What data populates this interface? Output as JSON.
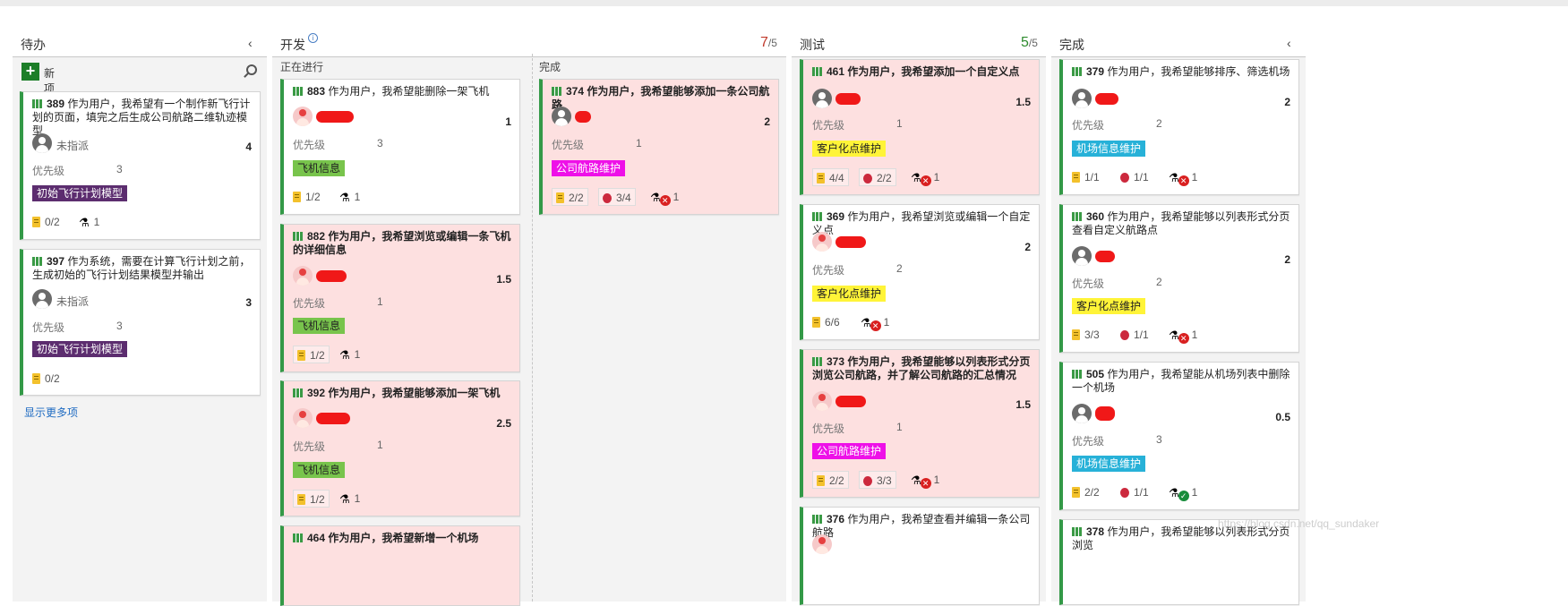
{
  "columns": {
    "todo": {
      "title": "待办",
      "new_item": "新项",
      "show_more": "显示更多项"
    },
    "dev": {
      "title": "开发",
      "wip_count": "7",
      "wip_limit": "/5",
      "sub_doing": "正在进行",
      "sub_done": "完成"
    },
    "test": {
      "title": "测试",
      "wip_count": "5",
      "wip_limit": "/5"
    },
    "done": {
      "title": "完成"
    }
  },
  "labels": {
    "priority": "优先级",
    "unassigned": "未指派"
  },
  "colors": {
    "story_green": "#339947",
    "wip_over": "#c0392b",
    "wip_ok": "#2e8b2e"
  },
  "cards": {
    "c389": {
      "id": "389",
      "title": "作为用户，我希望有一个制作新飞行计划的页面，填完之后生成公司航路二维轨迹模型",
      "effort": "4",
      "priority": "3",
      "tag": "初始飞行计划模型",
      "tasks": "0/2",
      "tests": "1"
    },
    "c397": {
      "id": "397",
      "title": "作为系统，需要在计算飞行计划之前，生成初始的飞行计划结果模型并输出",
      "effort": "3",
      "priority": "3",
      "tag": "初始飞行计划模型",
      "tasks": "0/2"
    },
    "c883": {
      "id": "883",
      "title": "作为用户，我希望能删除一架飞机",
      "effort": "1",
      "priority": "3",
      "tag": "飞机信息",
      "tasks": "1/2",
      "tests": "1"
    },
    "c882": {
      "id": "882",
      "title": "作为用户，我希望浏览或编辑一条飞机的详细信息",
      "effort": "1.5",
      "priority": "1",
      "tag": "飞机信息",
      "tasks": "1/2",
      "tests": "1"
    },
    "c392": {
      "id": "392",
      "title": "作为用户，我希望能够添加一架飞机",
      "effort": "2.5",
      "priority": "1",
      "tag": "飞机信息",
      "tasks": "1/2",
      "tests": "1"
    },
    "c464": {
      "id": "464",
      "title": "作为用户，我希望新增一个机场"
    },
    "c374": {
      "id": "374",
      "title": "作为用户，我希望能够添加一条公司航路",
      "effort": "2",
      "priority": "1",
      "tag": "公司航路维护",
      "tasks": "2/2",
      "bugs": "3/4",
      "tests": "1"
    },
    "c461": {
      "id": "461",
      "title": "作为用户，我希望添加一个自定义点",
      "effort": "1.5",
      "priority": "1",
      "tag": "客户化点维护",
      "tasks": "4/4",
      "bugs": "2/2",
      "tests": "1"
    },
    "c369": {
      "id": "369",
      "title": "作为用户，我希望浏览或编辑一个自定义点",
      "effort": "2",
      "priority": "2",
      "tag": "客户化点维护",
      "tasks": "6/6",
      "tests": "1"
    },
    "c373": {
      "id": "373",
      "title": "作为用户，我希望能够以列表形式分页浏览公司航路，并了解公司航路的汇总情况",
      "effort": "1.5",
      "priority": "1",
      "tag": "公司航路维护",
      "tasks": "2/2",
      "bugs": "3/3",
      "tests": "1"
    },
    "c376": {
      "id": "376",
      "title": "作为用户，我希望查看并编辑一条公司航路"
    },
    "c379": {
      "id": "379",
      "title": "作为用户，我希望能够排序、筛选机场",
      "effort": "2",
      "priority": "2",
      "tag": "机场信息维护",
      "tasks": "1/1",
      "bugs": "1/1",
      "tests": "1"
    },
    "c360": {
      "id": "360",
      "title": "作为用户，我希望能够以列表形式分页查看自定义航路点",
      "effort": "2",
      "priority": "2",
      "tag": "客户化点维护",
      "tasks": "3/3",
      "bugs": "1/1",
      "tests": "1"
    },
    "c505": {
      "id": "505",
      "title": "作为用户，我希望能从机场列表中删除一个机场",
      "effort": "0.5",
      "priority": "3",
      "tag": "机场信息维护",
      "tasks": "2/2",
      "bugs": "1/1",
      "tests": "1"
    },
    "c378": {
      "id": "378",
      "title": "作为用户，我希望能够以列表形式分页浏览"
    }
  },
  "watermark": "https://blog.csdn.net/qq_sundaker"
}
